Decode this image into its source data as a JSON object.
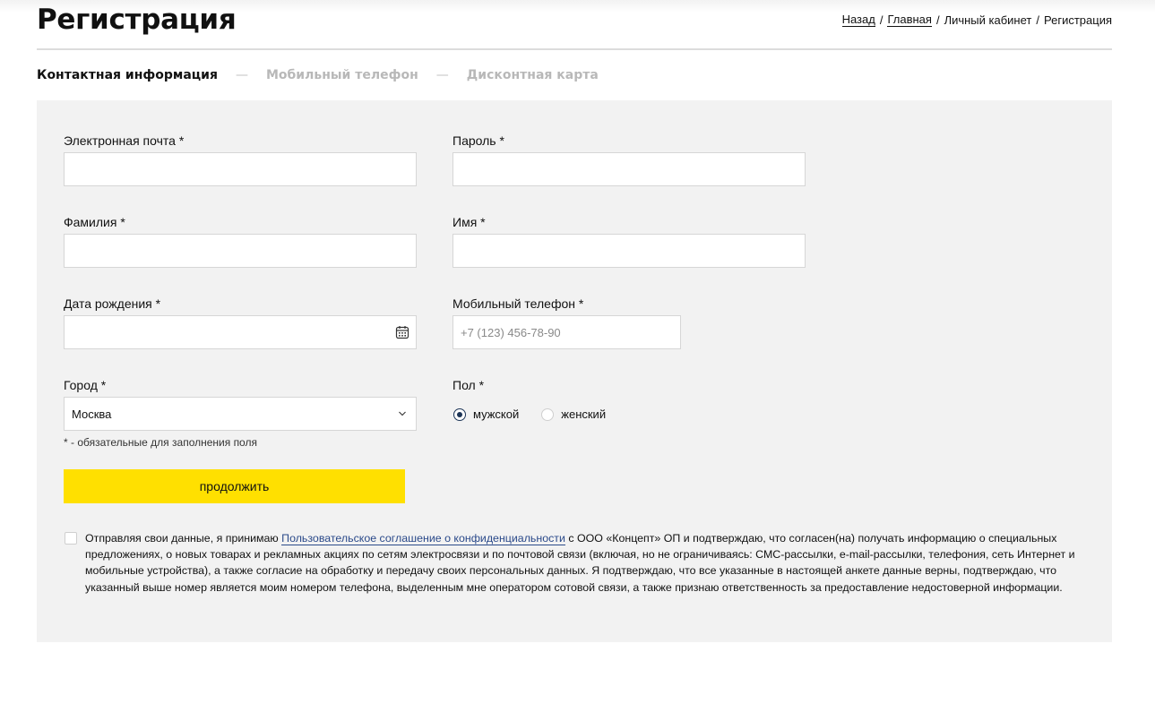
{
  "header": {
    "title": "Регистрация",
    "breadcrumb": {
      "back": "Назад",
      "home": "Главная",
      "account": "Личный кабинет",
      "current": "Регистрация",
      "separator": "/"
    }
  },
  "steps": {
    "items": [
      "Контактная информация",
      "Мобильный телефон",
      "Дисконтная карта"
    ],
    "separator": "—",
    "active_index": 0
  },
  "form": {
    "email": {
      "label": "Электронная почта *",
      "value": ""
    },
    "password": {
      "label": "Пароль *",
      "value": ""
    },
    "last_name": {
      "label": "Фамилия *",
      "value": ""
    },
    "first_name": {
      "label": "Имя *",
      "value": ""
    },
    "birth_date": {
      "label": "Дата рождения *",
      "value": ""
    },
    "phone": {
      "label": "Мобильный телефон *",
      "placeholder": "+7 (123) 456-78-90",
      "value": ""
    },
    "city": {
      "label": "Город *",
      "value": "Москва"
    },
    "gender": {
      "label": "Пол *",
      "options": [
        "мужской",
        "женский"
      ],
      "selected": "мужской"
    },
    "required_note": "* - обязательные для заполнения поля",
    "submit_label": "продолжить"
  },
  "consent": {
    "checked": false,
    "text_before": "Отправляя свои данные, я принимаю ",
    "link_text": "Пользовательское соглашение о конфиденциальности",
    "text_after": " с ООО «Концепт» ОП и подтверждаю, что согласен(на) получать информацию о специальных предложениях, о новых товарах и рекламных акциях по сетям электросвязи и по почтовой связи (включая, но не ограничиваясь: СМС-рассылки, e-mail-рассылки, телефония, сеть Интернет и мобильные устройства), а также согласие на обработку и передачу своих персональных данных. Я подтверждаю, что все указанные в настоящей анкете данные верны, подтверждаю, что указанный выше номер является моим номером телефона, выделенным мне оператором сотовой связи, а также признаю ответственность за предоставление недостоверной информации."
  },
  "colors": {
    "accent_button": "#ffe000",
    "panel_bg": "#f2f2f2",
    "link": "#2b4a8a",
    "radio_checked": "#1d3557"
  },
  "icons": {
    "date_picker": "calendar-icon",
    "select": "chevron-down-icon"
  }
}
